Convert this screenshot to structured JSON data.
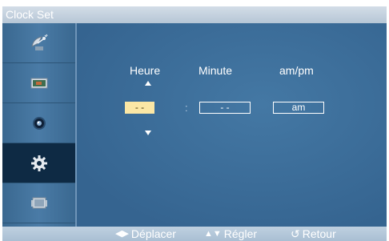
{
  "window": {
    "title": "Clock Set"
  },
  "sidebar": {
    "items": [
      {
        "icon": "satellite-dish-icon",
        "active": false
      },
      {
        "icon": "picture-icon",
        "active": false
      },
      {
        "icon": "sound-icon",
        "active": false
      },
      {
        "icon": "setup-gear-icon",
        "active": true
      },
      {
        "icon": "multi-control-icon",
        "active": false
      }
    ]
  },
  "clock": {
    "hour_label": "Heure",
    "minute_label": "Minute",
    "ampm_label": "am/pm",
    "hour_value": "- -",
    "minute_value": "- -",
    "ampm_value": "am",
    "separator": ":"
  },
  "footer": {
    "move_label": "Déplacer",
    "adjust_label": "Régler",
    "return_label": "Retour"
  },
  "colors": {
    "background": "#3d6a93",
    "active_field": "#fbe7a5",
    "active_sidebar": "#0e2a44"
  }
}
